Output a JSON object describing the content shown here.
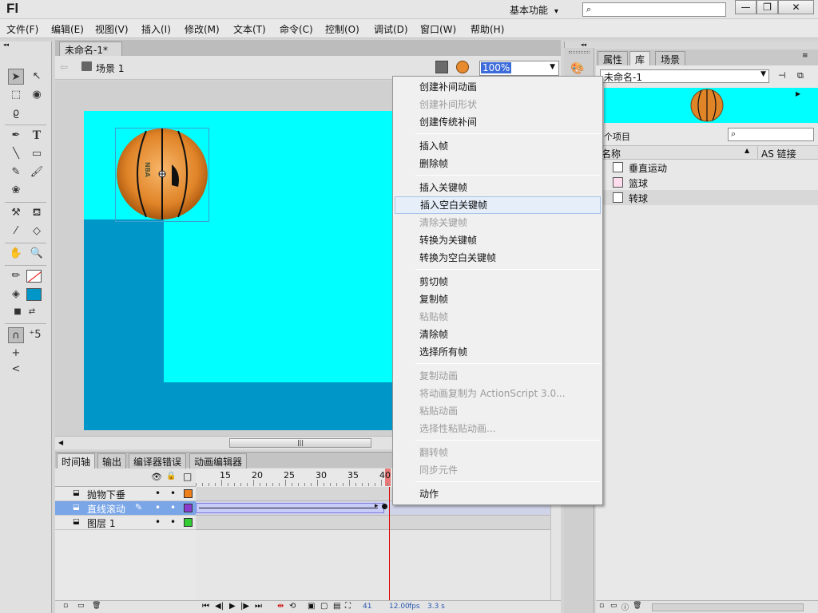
{
  "app": {
    "logo": "Fl",
    "workspace": "基本功能",
    "workspace_arrow": "▾",
    "search_icon": "⌕"
  },
  "window": {
    "minimize": "—",
    "restore": "❐",
    "close": "✕"
  },
  "menubar": [
    "文件(F)",
    "编辑(E)",
    "视图(V)",
    "插入(I)",
    "修改(M)",
    "文本(T)",
    "命令(C)",
    "控制(O)",
    "调试(D)",
    "窗口(W)",
    "帮助(H)"
  ],
  "doc_tab": {
    "label": "未命名-1*",
    "close": "×"
  },
  "edit_bar": {
    "back_arrow": "⇦",
    "scene": "场景 1",
    "zoom": "100%",
    "zoom_arrow": "▼"
  },
  "stage": {
    "ball_text": "NBA",
    "hscroll_grip": "|||",
    "colors": {
      "stage": "#00ffff",
      "block": "#0096c8",
      "ball": "#e88b2e"
    }
  },
  "timeline": {
    "tabs": [
      "时间轴",
      "输出",
      "编译器错误",
      "动画编辑器"
    ],
    "header_icons": {
      "eye": "👁",
      "lock": "🔒",
      "outline": "□"
    },
    "frame_ticks": [
      "15",
      "20",
      "25",
      "30",
      "35",
      "40"
    ],
    "layers": [
      {
        "name": "抛物下垂",
        "eye": "•",
        "lock": "•",
        "color": "#ef7f1a",
        "active": false
      },
      {
        "name": "直线滚动",
        "eye": "•",
        "lock": "•",
        "color": "#8b3ccf",
        "active": true
      },
      {
        "name": "图层 1",
        "eye": "•",
        "lock": "•",
        "color": "#33cc33",
        "active": false
      }
    ],
    "status": {
      "frame": "41",
      "fps": "12.00",
      "fps_unit": "fps",
      "time": "3.3 s"
    }
  },
  "context_menu": [
    {
      "label": "创建补间动画",
      "disabled": false
    },
    {
      "label": "创建补间形状",
      "disabled": true
    },
    {
      "label": "创建传统补间",
      "disabled": false
    },
    {
      "sep": true
    },
    {
      "label": "插入帧",
      "disabled": false
    },
    {
      "label": "删除帧",
      "disabled": false
    },
    {
      "sep": true
    },
    {
      "label": "插入关键帧",
      "disabled": false
    },
    {
      "label": "插入空白关键帧",
      "disabled": false,
      "highlight": true
    },
    {
      "label": "清除关键帧",
      "disabled": true
    },
    {
      "label": "转换为关键帧",
      "disabled": false
    },
    {
      "label": "转换为空白关键帧",
      "disabled": false
    },
    {
      "sep": true
    },
    {
      "label": "剪切帧",
      "disabled": false
    },
    {
      "label": "复制帧",
      "disabled": false
    },
    {
      "label": "粘贴帧",
      "disabled": true
    },
    {
      "label": "清除帧",
      "disabled": false
    },
    {
      "label": "选择所有帧",
      "disabled": false
    },
    {
      "sep": true
    },
    {
      "label": "复制动画",
      "disabled": true
    },
    {
      "label": "将动画复制为 ActionScript 3.0...",
      "disabled": true
    },
    {
      "label": "粘贴动画",
      "disabled": true
    },
    {
      "label": "选择性粘贴动画...",
      "disabled": true
    },
    {
      "sep": true
    },
    {
      "label": "翻转帧",
      "disabled": true
    },
    {
      "label": "同步元件",
      "disabled": true
    },
    {
      "sep": true
    },
    {
      "label": "动作",
      "disabled": false
    }
  ],
  "library": {
    "tabs": [
      "属性",
      "库",
      "场景"
    ],
    "doc": "未命名-1",
    "count_label": "个项目",
    "col_name": "名称",
    "col_link": "AS 链接",
    "items": [
      {
        "name": "垂直运动",
        "selected": false
      },
      {
        "name": "篮球",
        "selected": false
      },
      {
        "name": "转球",
        "selected": true
      }
    ]
  }
}
